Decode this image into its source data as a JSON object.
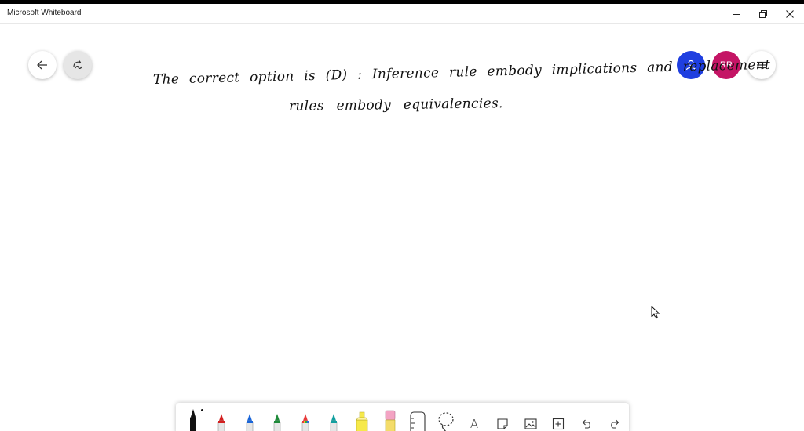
{
  "window": {
    "title": "Microsoft Whiteboard",
    "controls": [
      "minimize",
      "restore",
      "close"
    ]
  },
  "left_controls": {
    "back": {
      "icon": "arrow-left-icon"
    },
    "redraw": {
      "icon": "ink-replay-icon"
    }
  },
  "right_controls": {
    "invite": {
      "icon": "person-icon",
      "color": "#1f3fe0"
    },
    "avatar": {
      "initials": "RR",
      "color": "#c41565"
    },
    "menu": {
      "icon": "hamburger-menu-icon"
    }
  },
  "canvas": {
    "handwriting": [
      "The correct option is (D) : Inference rule embody implications and replacement",
      "rules embody equivalencies."
    ]
  },
  "toolbar": {
    "tools": [
      {
        "name": "pen-black",
        "color": "#111111",
        "active": true
      },
      {
        "name": "pen-red",
        "color": "#d32020"
      },
      {
        "name": "pen-blue",
        "color": "#1a66d9"
      },
      {
        "name": "pen-green",
        "color": "#1f8a3a"
      },
      {
        "name": "pen-rainbow",
        "color": "#e83a3a"
      },
      {
        "name": "pen-teal",
        "color": "#12a0a0"
      },
      {
        "name": "highlighter",
        "color": "#f6e94a"
      },
      {
        "name": "eraser",
        "color": "#f3a3c3"
      },
      {
        "name": "ruler"
      },
      {
        "name": "lasso"
      },
      {
        "name": "text",
        "label": "A"
      },
      {
        "name": "note"
      },
      {
        "name": "image"
      },
      {
        "name": "add"
      },
      {
        "name": "undo"
      },
      {
        "name": "redo"
      }
    ]
  }
}
